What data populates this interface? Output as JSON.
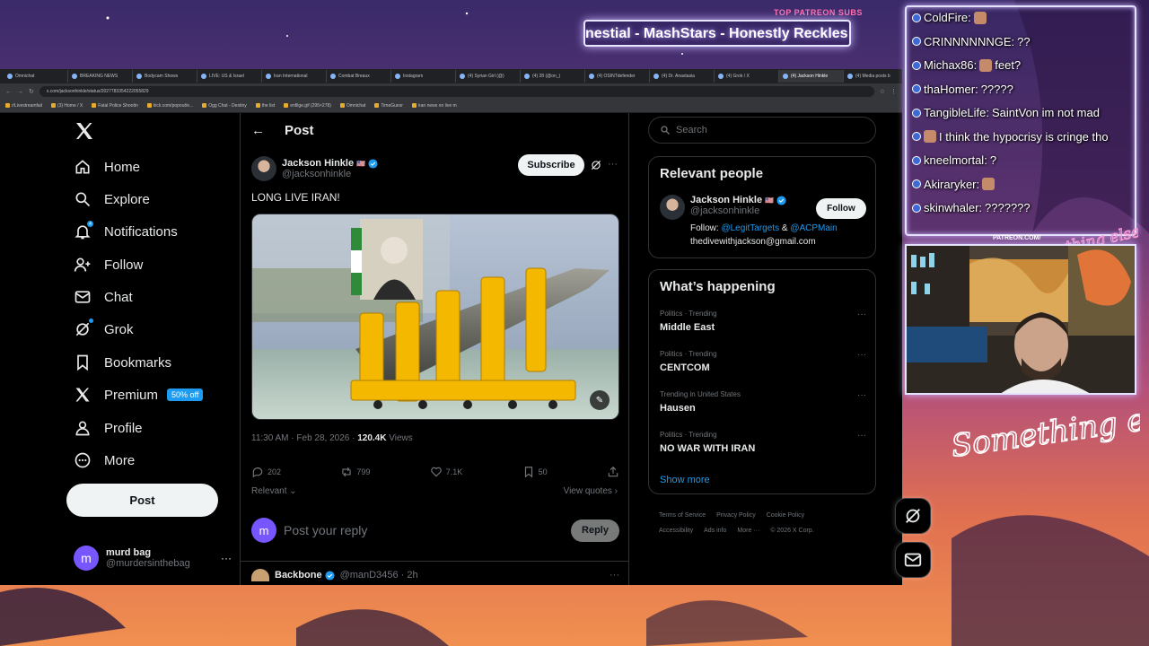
{
  "overlay": {
    "patreon_label": "TOP PATREON SUBS",
    "marquee_text": "nestial - MashStars - Honestly Reckles",
    "patreon_small": "PATREON.COM/",
    "neon_text_main": "Something else",
    "neon_text_small": "Anything else?"
  },
  "browser": {
    "tabs": [
      {
        "label": "Omnichat",
        "active": false
      },
      {
        "label": "BREAKING NEWS",
        "active": false
      },
      {
        "label": "Bodycam Shows",
        "active": false
      },
      {
        "label": "LIVE: US & Israel",
        "active": false
      },
      {
        "label": "Iran International",
        "active": false
      },
      {
        "label": "Combat Breaux",
        "active": false
      },
      {
        "label": "Instagram",
        "active": false
      },
      {
        "label": "(4) Syrian Girl (@)",
        "active": false
      },
      {
        "label": "(4) 28 (@on_)",
        "active": false
      },
      {
        "label": "(4) OSINTdefender",
        "active": false
      },
      {
        "label": "(4) Dr. Anastasia",
        "active": false
      },
      {
        "label": "(4) Grok / X",
        "active": false
      },
      {
        "label": "(4) Jackson Hinkle",
        "active": true
      },
      {
        "label": "(4) Media posts b",
        "active": false
      }
    ],
    "url": "x.com/jacksonhinkle/status/2027783354222055829",
    "bookmarks": [
      "r/Livestreamfail",
      "(3) Home / X",
      "Fatal Police Shootin",
      "kick.com/popout/e...",
      "Ogg Chat - Destiny",
      "the list",
      "enfilge.gif (295×278)",
      "Omnichat",
      "TimeGuesr",
      "iran news on live m"
    ]
  },
  "nav": {
    "items": [
      {
        "name": "home",
        "label": "Home"
      },
      {
        "name": "explore",
        "label": "Explore"
      },
      {
        "name": "notifications",
        "label": "Notifications",
        "badge": "4"
      },
      {
        "name": "follow",
        "label": "Follow"
      },
      {
        "name": "chat",
        "label": "Chat"
      },
      {
        "name": "grok",
        "label": "Grok"
      },
      {
        "name": "bookmarks",
        "label": "Bookmarks"
      },
      {
        "name": "premium",
        "label": "Premium",
        "badge": "50% off"
      },
      {
        "name": "profile",
        "label": "Profile"
      },
      {
        "name": "more",
        "label": "More"
      }
    ],
    "post_button": "Post",
    "account": {
      "initial": "m",
      "name": "murd bag",
      "handle": "@murdersinthebag"
    }
  },
  "post": {
    "header_title": "Post",
    "author_name": "Jackson Hinkle",
    "author_flag": "🇺🇸",
    "author_handle": "@jacksonhinkle",
    "subscribe_label": "Subscribe",
    "text": "LONG LIVE IRAN!",
    "time": "11:30 AM · Feb 28, 2026 · ",
    "views": "120.4K",
    "views_label": " Views",
    "replies": "202",
    "reposts": "799",
    "likes": "7.1K",
    "bookmarks": "50",
    "relevant_label": "Relevant",
    "view_quotes": "View quotes",
    "reply_initial": "m",
    "reply_placeholder": "Post your reply",
    "reply_button": "Reply",
    "next_post": {
      "name": "Backbone",
      "handle": "@manD3456 · 2h"
    }
  },
  "right": {
    "search_placeholder": "Search",
    "relevant_title": "Relevant people",
    "person": {
      "name": "Jackson Hinkle",
      "flag": "🇺🇸",
      "handle": "@jacksonhinkle",
      "follow_label": "Follow",
      "bio_prefix": "Follow: ",
      "bio_link1": "@LegitTargets",
      "bio_mid": " & ",
      "bio_link2": "@ACPMain",
      "bio_email": "thedivewithjackson@gmail.com"
    },
    "happening_title": "What’s happening",
    "trends": [
      {
        "category": "Politics · Trending",
        "title": "Middle East"
      },
      {
        "category": "Politics · Trending",
        "title": "CENTCOM"
      },
      {
        "category": "Trending in United States",
        "title": "Hausen"
      },
      {
        "category": "Politics · Trending",
        "title": "NO WAR WITH IRAN"
      }
    ],
    "show_more": "Show more",
    "footer": [
      "Terms of Service",
      "Privacy Policy",
      "Cookie Policy",
      "Accessibility",
      "Ads info",
      "More ···",
      "© 2026 X Corp."
    ]
  },
  "chat": {
    "lines": [
      {
        "user": "ColdFire:",
        "msg": "",
        "emote": true
      },
      {
        "user": "CRINNNNNNGE:",
        "msg": "??",
        "emote": false
      },
      {
        "user": "Michax86:",
        "msg": "feet?",
        "emote": true
      },
      {
        "user": "thaHomer:",
        "msg": "?????",
        "emote": false
      },
      {
        "user": "TangibleLife:",
        "msg": "SaintVon im not mad",
        "emote": false
      },
      {
        "user": "",
        "msg": "I think the hypocrisy is cringe tho",
        "emote": true
      },
      {
        "user": "kneelmortal:",
        "msg": "?",
        "emote": false
      },
      {
        "user": "Akiraryker:",
        "msg": "",
        "emote": true
      },
      {
        "user": "skinwhaler:",
        "msg": "???????",
        "emote": false
      }
    ]
  }
}
